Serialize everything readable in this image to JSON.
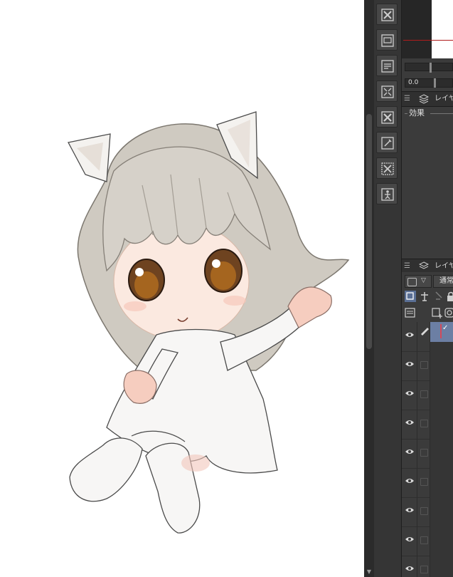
{
  "canvas": {
    "background": "#ffffff",
    "subject": "illustration"
  },
  "tool_column": {
    "buttons": [
      {
        "icon": "clear-layer-icon"
      },
      {
        "icon": "save-icon"
      },
      {
        "icon": "export-icon"
      },
      {
        "icon": "transform-icon"
      },
      {
        "icon": "delete-icon"
      },
      {
        "icon": "edit-icon"
      },
      {
        "icon": "clear-selection-icon"
      },
      {
        "icon": "pose-figure-icon"
      }
    ]
  },
  "navigator": {
    "rotation_value": "0.0"
  },
  "layer_property_panel": {
    "tab_label": "レイヤー",
    "effects_label": "効果"
  },
  "layer_panel": {
    "tab_label": "レイヤー",
    "blend_mode": "通常",
    "active_checkmark": "✓"
  },
  "colors": {
    "panel_bg": "#3b3b3b",
    "tool_bg": "#353535",
    "selection": "#6c7fa4",
    "navigator_frame": "#b01c1c"
  }
}
